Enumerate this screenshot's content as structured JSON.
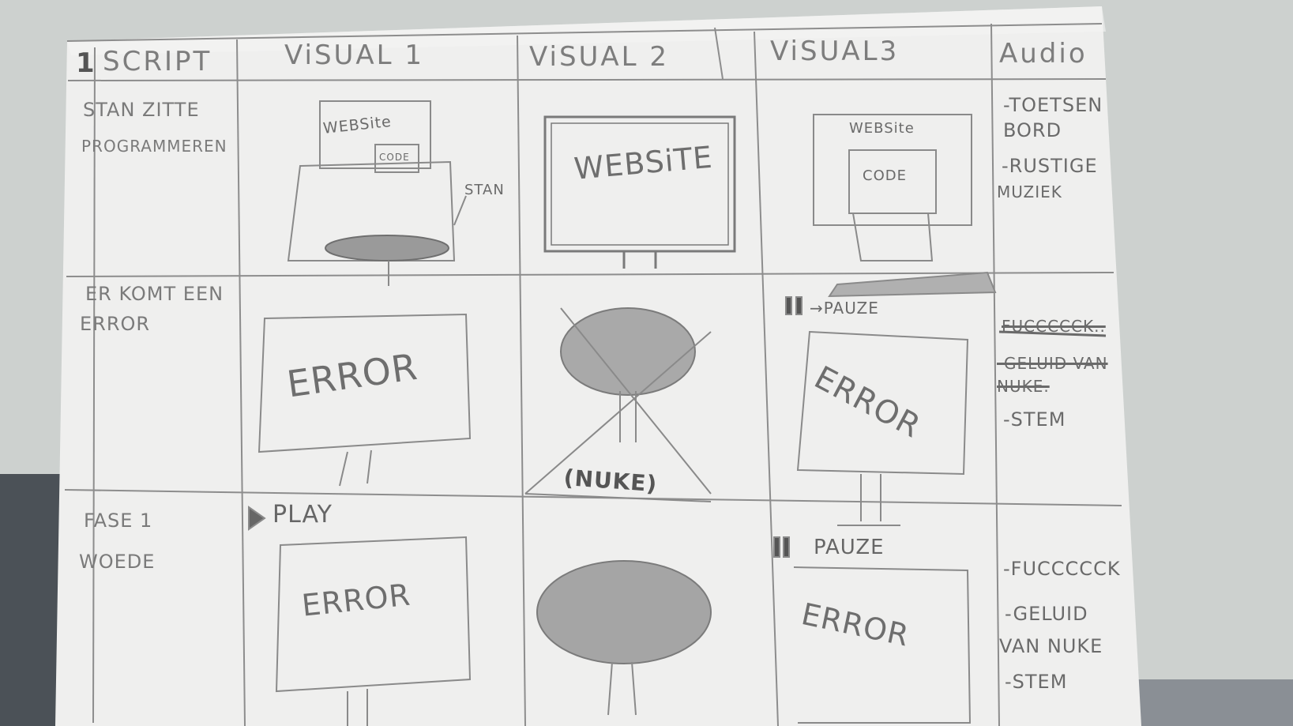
{
  "storyboard": {
    "headers": {
      "number": "1",
      "script": "SCRIPT",
      "visual1": "ViSUAL 1",
      "visual2": "ViSUAL 2",
      "visual3": "ViSUAL3",
      "audio": "Audio"
    },
    "rows": [
      {
        "script": [
          "STAN ZITTE",
          "PROGRAMMEREN"
        ],
        "visual1": {
          "website": "WEBSite",
          "code": "CODE",
          "arrow_label": "STAN"
        },
        "visual2": {
          "screen": "WEBSiTE"
        },
        "visual3": {
          "website": "WEBSite",
          "code": "CODE"
        },
        "audio": [
          "-TOETSEN",
          "BORD",
          "-RUSTIGE",
          "MUZIEK"
        ]
      },
      {
        "script": [
          "ER KOMT EEN",
          "ERROR"
        ],
        "visual1": {
          "screen": "ERROR"
        },
        "visual2": {
          "label": "(NUKE)"
        },
        "visual3": {
          "pause": "→PAUZE",
          "screen": "ERROR"
        },
        "audio": [
          "FUCCCCCK..",
          "-GELUID VAN",
          "NUKE.",
          "-STEM"
        ]
      },
      {
        "script": [
          "FASE 1",
          "WOEDE"
        ],
        "visual1": {
          "play": "PLAY",
          "screen": "ERROR"
        },
        "visual3": {
          "pause": "PAUZE",
          "screen": "ERROR"
        },
        "audio": [
          "-FUCCCCCK",
          "-GELUID",
          "VAN NUKE",
          "-STEM"
        ]
      }
    ]
  }
}
